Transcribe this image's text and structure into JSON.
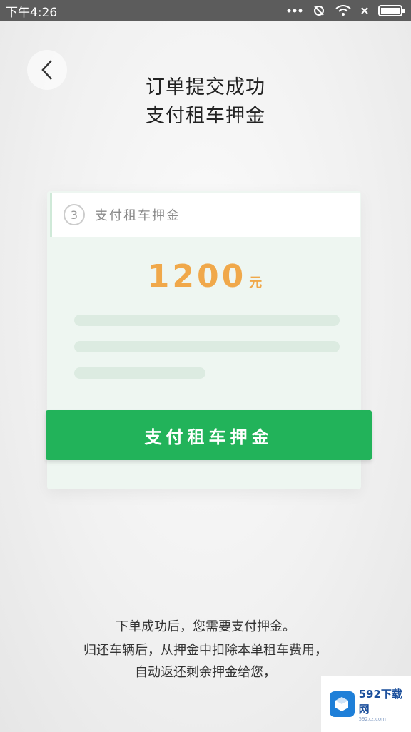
{
  "status_bar": {
    "time": "下午4:26"
  },
  "header": {
    "back_icon": "chevron-left-icon",
    "title_line1": "订单提交成功",
    "title_line2": "支付租车押金"
  },
  "card": {
    "step_number": "3",
    "step_label": "支付租车押金",
    "amount": "1200",
    "unit": "元",
    "amount_color": "#f0a84a"
  },
  "pay_button": {
    "label": "支付租车押金",
    "color": "#22b35a"
  },
  "footer": {
    "line1": "下单成功后，您需要支付押金。",
    "line2": "归还车辆后，从押金中扣除本单租车费用，",
    "line3": "自动返还剩余押金给您，"
  },
  "watermark": {
    "text": "592下载网",
    "sub": "592xz.com"
  }
}
